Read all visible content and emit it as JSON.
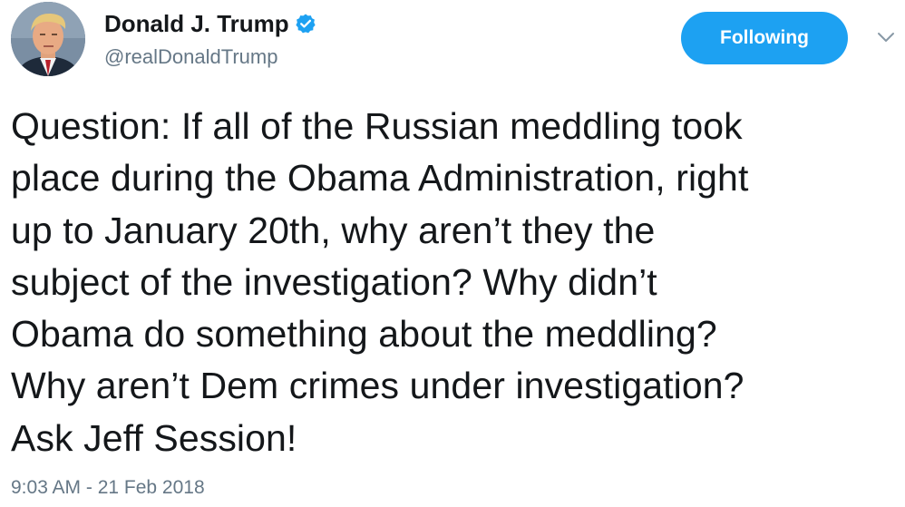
{
  "author": {
    "display_name": "Donald J. Trump",
    "handle": "@realDonaldTrump",
    "verified": true,
    "avatar_icon": "profile-photo"
  },
  "follow_button": {
    "label": "Following",
    "color": "#1da1f2"
  },
  "menu": {
    "icon": "chevron-down-icon"
  },
  "tweet": {
    "text": "Question: If all of the Russian meddling took\nplace during the Obama Administration, right\nup to January 20th, why aren’t they the\nsubject of the investigation? Why didn’t\nObama do something about the meddling?\nWhy aren’t Dem crimes under investigation?\nAsk Jeff Session!",
    "timestamp": "9:03 AM - 21 Feb 2018"
  },
  "colors": {
    "text": "#14171a",
    "secondary": "#657786",
    "accent": "#1da1f2"
  }
}
